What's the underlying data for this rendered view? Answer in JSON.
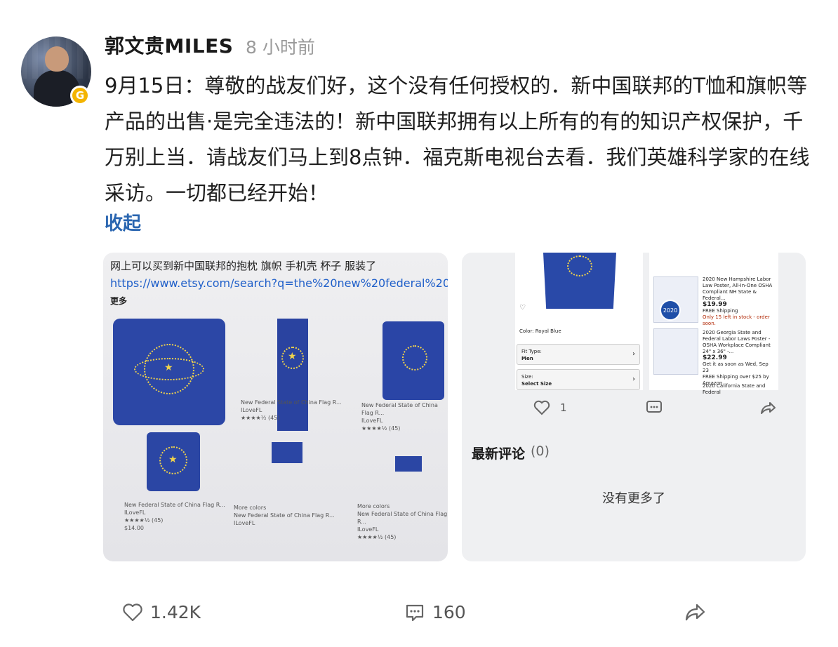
{
  "post": {
    "author": "郭文贵MILES",
    "badge": "G",
    "time": "8 小时前",
    "text": "9月15日：尊敬的战友们好，这个没有任何授权的．新中国联邦的T恤和旗帜等产品的出售·是完全违法的！新中国联邦拥有以上所有的有的知识产权保护，千万别上当．请战友们马上到8点钟．福克斯电视台去看．我们英雄科学家的在线采访。一切都已经开始！",
    "collapse_label": "收起"
  },
  "image1": {
    "caption": "网上可以买到新中国联邦的抱枕 旗帜 手机壳 杯子 服装了",
    "url": "https://www.etsy.com/search?q=the%20new%20federal%20s",
    "more": "更多",
    "items": [
      {
        "title": "New Federal State of China Flag R...",
        "shop": "ILoveFL",
        "rating": "★★★★½ (45)"
      },
      {
        "title": "New Federal State of China Flag R...",
        "shop": "ILoveFL",
        "rating": "★★★★½ (45)"
      },
      {
        "title": "New Federal State of China Flag R...",
        "shop": "ILoveFL",
        "rating": "★★★★½ (45)",
        "price": "$14.00"
      },
      {
        "title": "New Federal State of China Flag R...",
        "shop": "ILoveFL",
        "note": "More colors"
      },
      {
        "title": "New Federal State of China Flag R...",
        "shop": "ILoveFL",
        "rating": "★★★★½ (45)",
        "note": "More colors"
      }
    ]
  },
  "image2": {
    "color_label": "Color: Royal Blue",
    "fit_type_label": "Fit Type:",
    "fit_type_value": "Men",
    "size_label": "Size:",
    "size_value": "Select Size",
    "posters": [
      {
        "title": "2020 New Hampshire Labor Law Poster, All-In-One OSHA Compliant NH State & Federal...",
        "price": "$19.99",
        "shipping": "FREE Shipping",
        "stock": "Only 15 left in stock - order soon."
      },
      {
        "title": "2020 Georgia State and Federal Labor Laws Poster - OSHA Workplace Compliant 24\" x 36\" -...",
        "price": "$22.99",
        "delivery": "Get it as soon as Wed, Sep 23",
        "shipping": "FREE Shipping over $25 by Amazon"
      },
      {
        "title": "2020 California State and Federal"
      }
    ],
    "seal_text": "2020",
    "likes": "1",
    "comments_title": "最新评论",
    "comments_count": "(0)",
    "no_more": "没有更多了"
  },
  "footer": {
    "likes": "1.42K",
    "comments": "160"
  },
  "icons": [
    "heart-icon",
    "comment-icon",
    "share-icon",
    "chevron-right-icon"
  ],
  "colors": {
    "link": "#2965b0",
    "flag_blue": "#2b46a4",
    "star_yellow": "#f1d34b"
  }
}
